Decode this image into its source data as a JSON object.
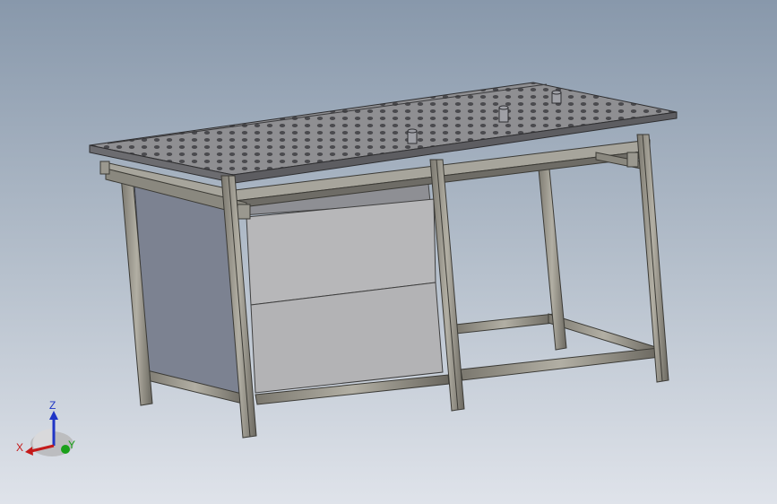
{
  "scene": {
    "model": "welding-table",
    "background_top": "#8a9bad",
    "background_bottom": "#dde2e9",
    "frame_color": "#9c9a8f",
    "frame_dark": "#5f5d55",
    "panel_color": "#b8b8b8",
    "top_plate_color": "#8c8c8e"
  },
  "triad": {
    "z_label": "Z",
    "x_label": "X",
    "y_label": "Y",
    "z_color": "#1f35c6",
    "x_color": "#c41a1a",
    "y_color": "#1aa01a"
  }
}
